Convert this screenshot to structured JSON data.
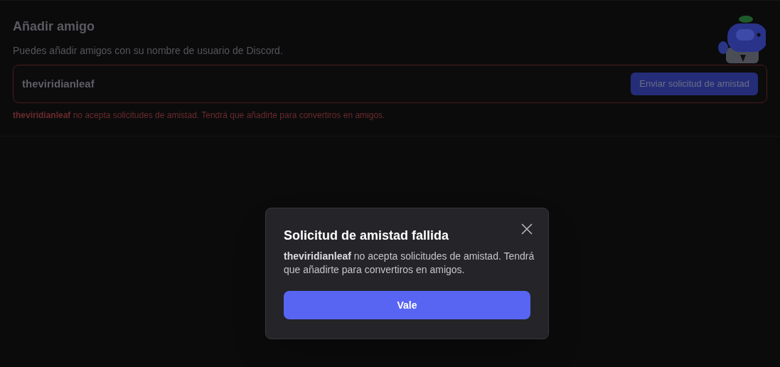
{
  "add_friend": {
    "title": "Añadir amigo",
    "subtitle": "Puedes añadir amigos con su nombre de usuario de Discord.",
    "field": {
      "value": "theviridianleaf",
      "error": true
    },
    "send_button": {
      "label": "Enviar solicitud de amistad",
      "disabled": true
    },
    "error_message": "**theviridianleaf** no acepta solicitudes de amistad. Tendrá que añadirte para convertiros en amigos."
  },
  "dialog": {
    "title": "Solicitud de amistad fallida",
    "message": "**theviridianleaf** no acepta solicitudes de amistad. Tendrá que añadirte para convertiros en amigos.",
    "button": "Vale"
  }
}
